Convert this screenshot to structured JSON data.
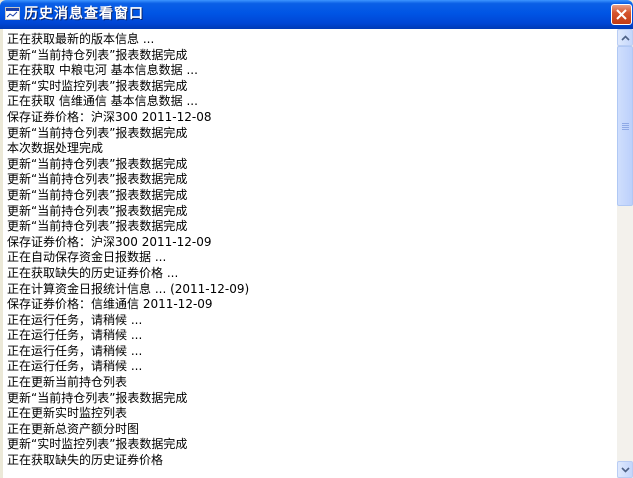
{
  "window": {
    "title": "历史消息查看窗口"
  },
  "icons": {
    "app": "window-icon",
    "close": "close-icon",
    "scroll_up": "arrow-up-icon",
    "scroll_down": "arrow-down-icon"
  },
  "colors": {
    "titlebar": "#0055e5",
    "close_button": "#d6552e",
    "log_text": "#000000",
    "log_background": "#ffffff"
  },
  "log": {
    "lines": [
      "正在获取最新的版本信息 ...",
      "更新“当前持仓列表”报表数据完成",
      "正在获取 中粮屯河 基本信息数据 ...",
      "更新“实时监控列表”报表数据完成",
      "正在获取 信维通信 基本信息数据 ...",
      "保存证券价格：沪深300 2011-12-08",
      "更新“当前持仓列表”报表数据完成",
      "本次数据处理完成",
      "更新“当前持仓列表”报表数据完成",
      "更新“当前持仓列表”报表数据完成",
      "更新“当前持仓列表”报表数据完成",
      "更新“当前持仓列表”报表数据完成",
      "更新“当前持仓列表”报表数据完成",
      "保存证券价格：沪深300 2011-12-09",
      "正在自动保存资金日报数据 ...",
      "正在获取缺失的历史证券价格 ...",
      "正在计算资金日报统计信息 ... (2011-12-09)",
      "保存证券价格：信维通信 2011-12-09",
      "正在运行任务，请稍候 ...",
      "正在运行任务，请稍候 ...",
      "正在运行任务，请稍候 ...",
      "正在运行任务，请稍候 ...",
      "正在更新当前持仓列表",
      "更新“当前持仓列表”报表数据完成",
      "正在更新实时监控列表",
      "正在更新总资产额分时图",
      "更新“实时监控列表”报表数据完成",
      "正在获取缺失的历史证券价格"
    ]
  },
  "scrollbar": {
    "position_fraction": 0.0
  }
}
